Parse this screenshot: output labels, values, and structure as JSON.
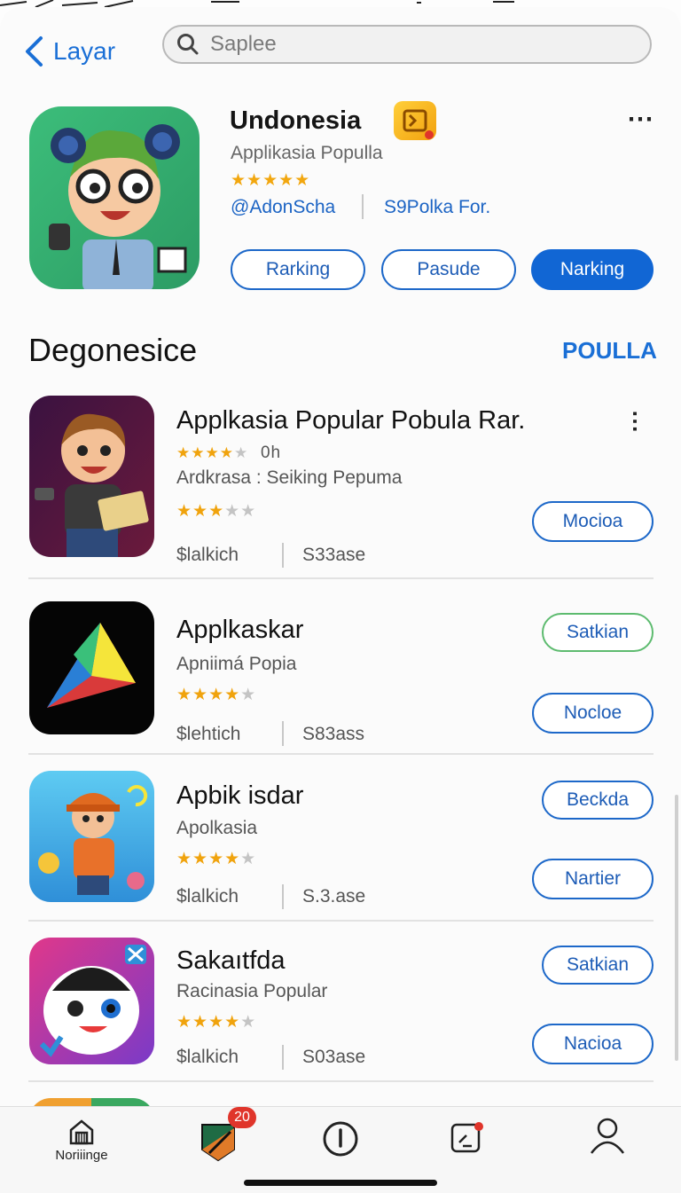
{
  "header": {
    "back_label": "Layar",
    "search_placeholder": "Saplee"
  },
  "featured": {
    "title": "Undonesia",
    "subtitle": "Applikasia Populla",
    "stars": "★★★★★",
    "developer": "@AdonScha",
    "category": "S9Polka For.",
    "buttons": [
      "Rarking",
      "Pasude",
      "Narking"
    ]
  },
  "section": {
    "title": "Degonesice",
    "link": "POULLA"
  },
  "apps": [
    {
      "title": "Applkasia Popular Pobula Rar.",
      "small_stars_on": "★★★★",
      "small_stars_off": "★",
      "small_stars_text": "0h",
      "subtitle": "Ardkrasa : Seiking Pepuma",
      "stars_on": "★★★",
      "stars_off": "★★",
      "price": "$lalkich",
      "size": "S33ase",
      "button": "Mocioa"
    },
    {
      "title": "Applkaskar",
      "subtitle": "Apniimá Popia",
      "stars_on": "★★★★",
      "stars_off": "★",
      "price": "$lehtich",
      "size": "S83ass",
      "button_top": "Satkian",
      "button": "Nocloe"
    },
    {
      "title": "Apbik isdar",
      "subtitle": "Apolkasia",
      "stars_on": "★★★★",
      "stars_off": "★",
      "price": "$lalkich",
      "size": "S.3.ase",
      "button_top": "Beckda",
      "button": "Nartier"
    },
    {
      "title": "Sakaıtfda",
      "subtitle": "Racinasia Popular",
      "stars_on": "★★★★",
      "stars_off": "★",
      "price": "$lalkich",
      "size": "S03ase",
      "button_top": "Satkian",
      "button": "Nacioa"
    }
  ],
  "tabbar": {
    "home_label": "Noriiinge",
    "badge_count": "20"
  },
  "colors": {
    "accent": "#1a6fd6",
    "star": "#f0a30d",
    "badge": "#e0352b"
  }
}
